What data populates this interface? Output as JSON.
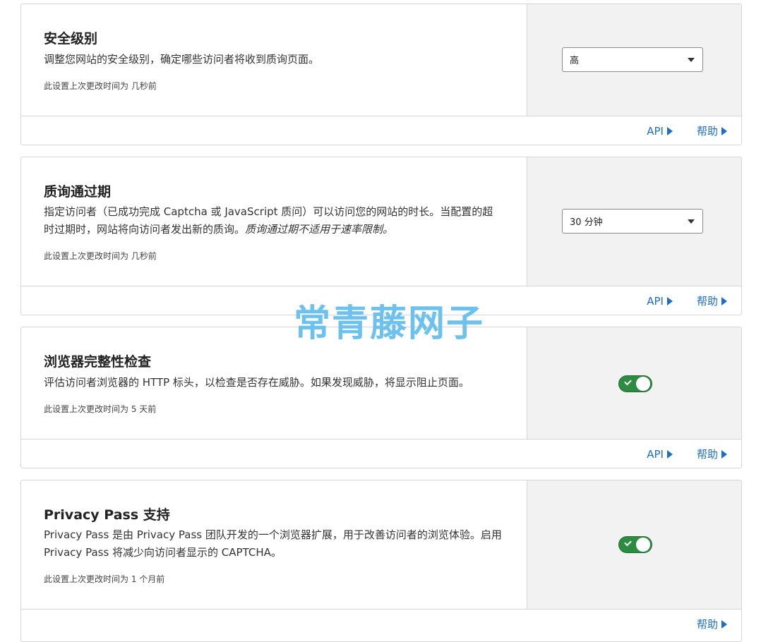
{
  "cards": [
    {
      "title": "安全级别",
      "description": "调整您网站的安全级别，确定哪些访问者将收到质询页面。",
      "modified": "此设置上次更改时间为 几秒前",
      "control": {
        "type": "select",
        "value": "高"
      },
      "links": [
        "API",
        "帮助"
      ]
    },
    {
      "title": "质询通过期",
      "description_plain": "指定访问者（已成功完成 Captcha 或 JavaScript 质问）可以访问您的网站的时长。当配置的超时过期时，网站将向访问者发出新的质询。",
      "description_italic": "质询通过期不适用于速率限制。",
      "modified": "此设置上次更改时间为 几秒前",
      "control": {
        "type": "select",
        "value": "30 分钟"
      },
      "links": [
        "API",
        "帮助"
      ]
    },
    {
      "title": "浏览器完整性检查",
      "description": "评估访问者浏览器的 HTTP 标头，以检查是否存在威胁。如果发现威胁，将显示阻止页面。",
      "modified": "此设置上次更改时间为 5 天前",
      "control": {
        "type": "toggle",
        "checked": true
      },
      "links": [
        "API",
        "帮助"
      ]
    },
    {
      "title": "Privacy Pass 支持",
      "description": "Privacy Pass 是由 Privacy Pass 团队开发的一个浏览器扩展，用于改善访问者的浏览体验。启用 Privacy Pass 将减少向访问者显示的 CAPTCHA。",
      "modified": "此设置上次更改时间为 1 个月前",
      "control": {
        "type": "toggle",
        "checked": true
      },
      "links": [
        "帮助"
      ]
    }
  ],
  "watermark": "常青藤网子",
  "colors": {
    "link": "#1c6fc4",
    "toggle_on": "#2e8b42",
    "panel_bg": "#f2f2f2",
    "border": "#d6d6d6"
  },
  "icons": {
    "link_arrow": "triangle-right-icon",
    "select_caret": "chevron-down-icon",
    "toggle_check": "check-icon"
  }
}
